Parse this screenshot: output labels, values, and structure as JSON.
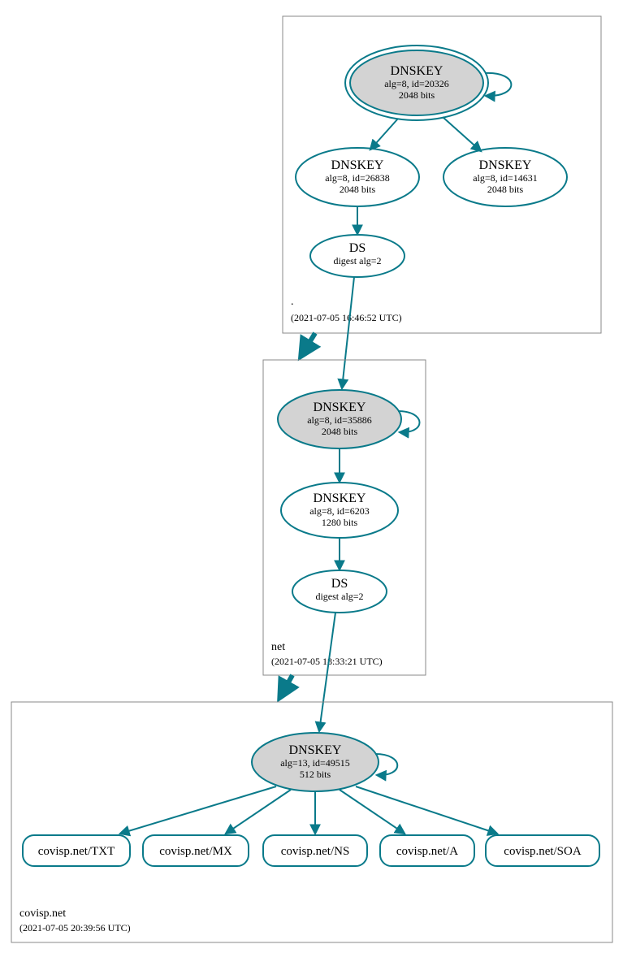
{
  "colors": {
    "accent": "#0a7a8a",
    "node_fill": "#d3d3d3",
    "box_stroke": "#888888"
  },
  "zones": {
    "root": {
      "name": ".",
      "timestamp": "(2021-07-05 16:46:52 UTC)"
    },
    "net": {
      "name": "net",
      "timestamp": "(2021-07-05 18:33:21 UTC)"
    },
    "covisp": {
      "name": "covisp.net",
      "timestamp": "(2021-07-05 20:39:56 UTC)"
    }
  },
  "nodes": {
    "root_ksk": {
      "title": "DNSKEY",
      "alg": "alg=8, id=20326",
      "bits": "2048 bits"
    },
    "root_zsk1": {
      "title": "DNSKEY",
      "alg": "alg=8, id=26838",
      "bits": "2048 bits"
    },
    "root_zsk2": {
      "title": "DNSKEY",
      "alg": "alg=8, id=14631",
      "bits": "2048 bits"
    },
    "root_ds": {
      "title": "DS",
      "alg": "digest alg=2"
    },
    "net_ksk": {
      "title": "DNSKEY",
      "alg": "alg=8, id=35886",
      "bits": "2048 bits"
    },
    "net_zsk": {
      "title": "DNSKEY",
      "alg": "alg=8, id=6203",
      "bits": "1280 bits"
    },
    "net_ds": {
      "title": "DS",
      "alg": "digest alg=2"
    },
    "covisp_ksk": {
      "title": "DNSKEY",
      "alg": "alg=13, id=49515",
      "bits": "512 bits"
    }
  },
  "rr": {
    "txt": "covisp.net/TXT",
    "mx": "covisp.net/MX",
    "ns": "covisp.net/NS",
    "a": "covisp.net/A",
    "soa": "covisp.net/SOA"
  }
}
